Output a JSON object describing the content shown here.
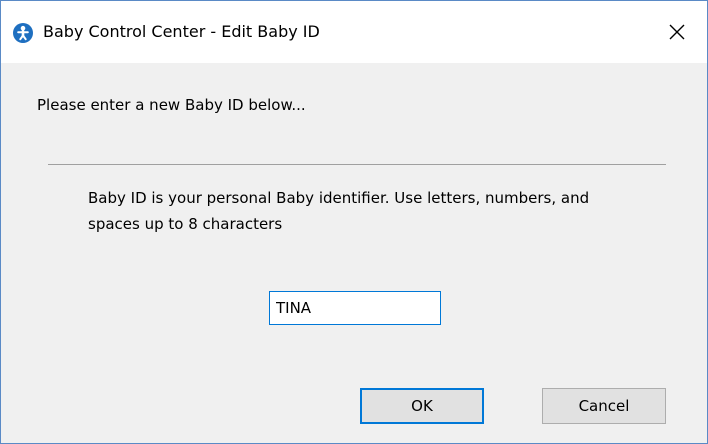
{
  "window": {
    "title": "Baby Control Center - Edit Baby ID",
    "app_icon": "baby-app-icon",
    "close_icon": "close-icon"
  },
  "dialog": {
    "prompt": "Please enter a new Baby ID below...",
    "help_text": "Baby ID is your personal Baby identifier. Use letters, numbers, and spaces up to 8 characters",
    "baby_id_value": "TINA"
  },
  "buttons": {
    "ok_label": "OK",
    "cancel_label": "Cancel"
  },
  "colors": {
    "accent": "#0078d7",
    "window_border": "#5a8ac6",
    "dialog_background": "#f0f0f0",
    "button_face": "#e1e1e1"
  }
}
